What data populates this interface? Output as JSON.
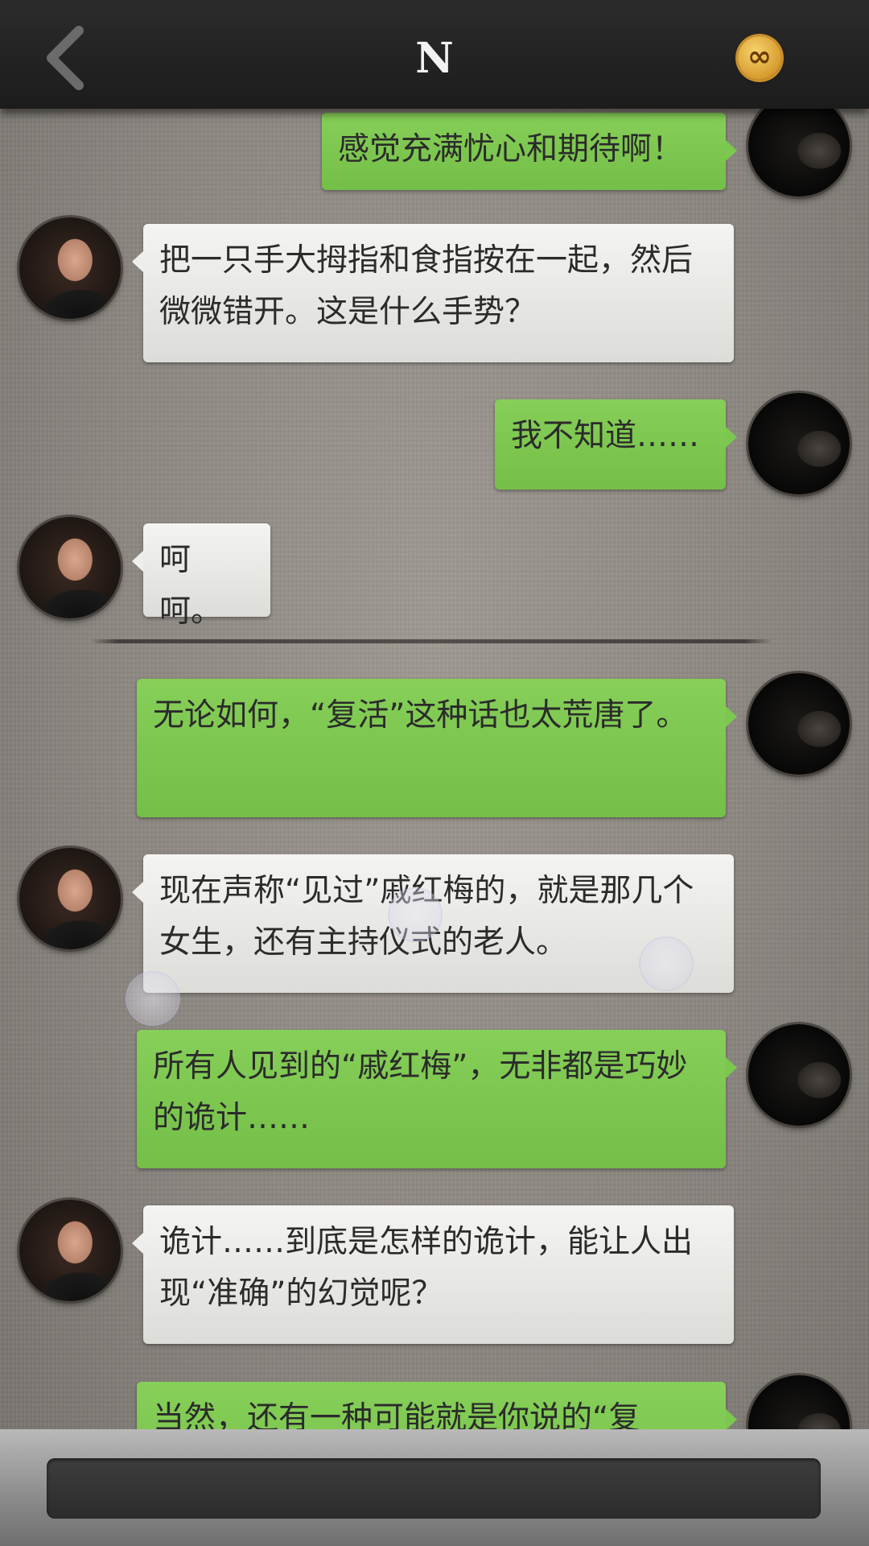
{
  "header": {
    "title": "N",
    "back_icon": "chevron-left-icon",
    "coin_icon": "infinity-coin-icon",
    "coin_symbol": "∞"
  },
  "messages": [
    {
      "sender": "me",
      "text": "感觉充满忧心和期待啊！"
    },
    {
      "sender": "friend",
      "text": "把一只手大拇指和食指按在一起，然后微微错开。这是什么手势？"
    },
    {
      "sender": "me",
      "text": "我不知道……"
    },
    {
      "sender": "friend",
      "text": "呵呵。"
    },
    {
      "sender": "me",
      "text": "无论如何，“复活”这种话也太荒唐了。"
    },
    {
      "sender": "friend",
      "text": "现在声称“见过”戚红梅的，就是那几个女生，还有主持仪式的老人。"
    },
    {
      "sender": "me",
      "text": "所有人见到的“戚红梅”，无非都是巧妙的诡计……"
    },
    {
      "sender": "friend",
      "text": "诡计……到底是怎样的诡计，能让人出现“准确”的幻觉呢？"
    },
    {
      "sender": "me",
      "text": "当然，还有一种可能就是你说的“复"
    }
  ],
  "colors": {
    "right_bubble": "#7cc74f",
    "left_bubble": "#eeeeec",
    "header": "#222222"
  },
  "footer": {
    "input_value": ""
  }
}
